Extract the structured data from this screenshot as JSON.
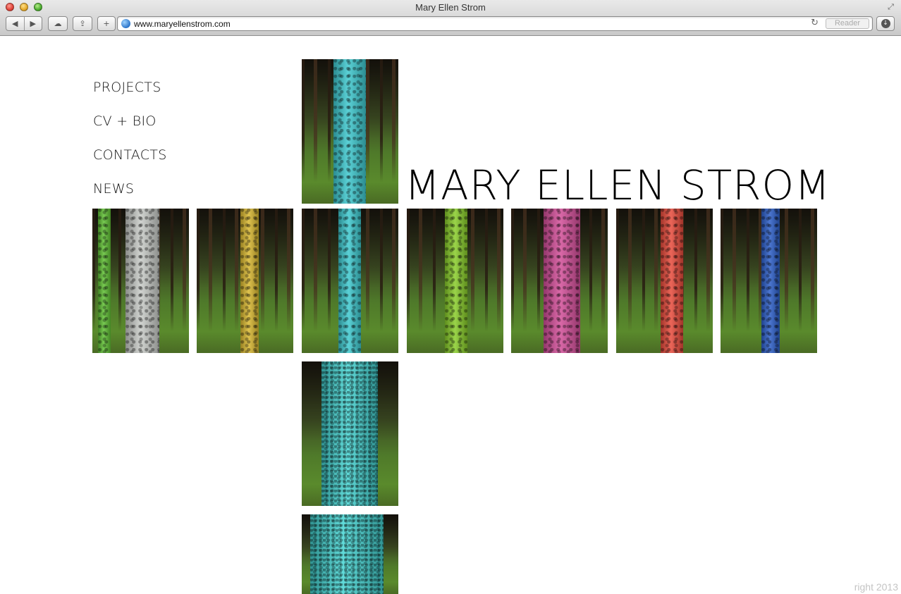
{
  "browser": {
    "window_title": "Mary Ellen Strom",
    "url": "www.maryellenstrom.com",
    "reader_label": "Reader",
    "back_glyph": "◀",
    "forward_glyph": "▶",
    "cloud_glyph": "☁",
    "share_glyph": "⇪",
    "add_glyph": "+",
    "reload_glyph": "↻",
    "download_glyph": "↓",
    "fullscreen_glyph": "⤢"
  },
  "page": {
    "nav": [
      {
        "label": "PROJECTS"
      },
      {
        "label": "CV + BIO"
      },
      {
        "label": "CONTACTS"
      },
      {
        "label": "NEWS"
      }
    ],
    "title": "MARY ELLEN STROM",
    "footer": "right 2013"
  },
  "gallery": [
    {
      "name": "photo-tree-turquoise-top",
      "trunk_color": "#3ec9cf",
      "style": "standard"
    },
    {
      "name": "photo-tree-silver",
      "trunk_color": "#c9ccc8",
      "style": "standard",
      "secondary_color": "#5fbf33"
    },
    {
      "name": "photo-tree-yellow",
      "trunk_color": "#d9b830",
      "style": "standard"
    },
    {
      "name": "photo-tree-turquoise-center",
      "trunk_color": "#3ec9cf",
      "style": "standard"
    },
    {
      "name": "photo-tree-green",
      "trunk_color": "#88cc2a",
      "style": "standard"
    },
    {
      "name": "photo-tree-pink",
      "trunk_color": "#d44f9a",
      "style": "standard"
    },
    {
      "name": "photo-tree-red",
      "trunk_color": "#e84b3c",
      "style": "standard"
    },
    {
      "name": "photo-tree-blue",
      "trunk_color": "#2d5fc9",
      "style": "standard"
    },
    {
      "name": "photo-tree-turquoise-closeup",
      "trunk_color": "#45d4d2",
      "style": "closeup"
    },
    {
      "name": "photo-tree-turquoise-closeup-bottom",
      "trunk_color": "#45d4d2",
      "style": "closeup"
    }
  ]
}
